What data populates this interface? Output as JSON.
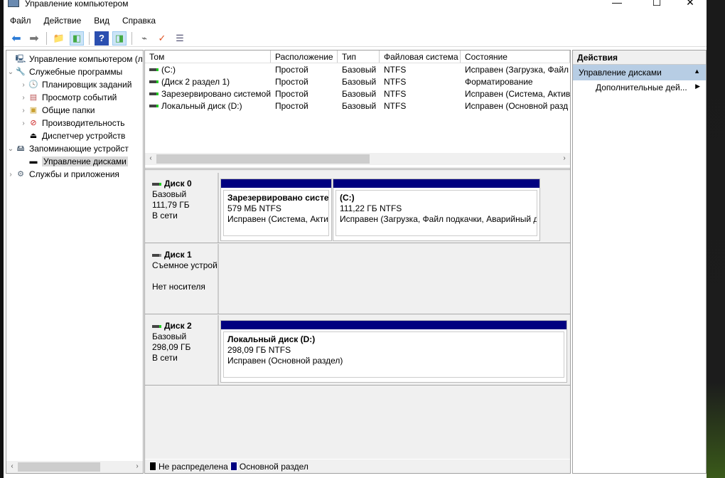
{
  "window": {
    "title": "Управление компьютером",
    "minimize": "—",
    "maximize": "☐",
    "close": "✕"
  },
  "menu": [
    "Файл",
    "Действие",
    "Вид",
    "Справка"
  ],
  "tree": [
    {
      "label": "Управление компьютером (л",
      "icon": "computer-icon"
    },
    {
      "label": "Служебные программы",
      "icon": "tools-icon"
    },
    {
      "label": "Планировщик заданий",
      "icon": "clock-icon"
    },
    {
      "label": "Просмотр событий",
      "icon": "event-viewer-icon"
    },
    {
      "label": "Общие папки",
      "icon": "shared-folder-icon"
    },
    {
      "label": "Производительность",
      "icon": "performance-icon"
    },
    {
      "label": "Диспетчер устройств",
      "icon": "device-manager-icon"
    },
    {
      "label": "Запоминающие устройст",
      "icon": "storage-icon"
    },
    {
      "label": "Управление дисками",
      "icon": "disk-icon"
    },
    {
      "label": "Службы и приложения",
      "icon": "services-icon"
    }
  ],
  "volumes": {
    "columns": [
      "Том",
      "Расположение",
      "Тип",
      "Файловая система",
      "Состояние"
    ],
    "rows": [
      [
        "(C:)",
        "Простой",
        "Базовый",
        "NTFS",
        "Исправен (Загрузка, Файл"
      ],
      [
        "(Диск 2 раздел 1)",
        "Простой",
        "Базовый",
        "NTFS",
        "Форматирование"
      ],
      [
        "Зарезервировано системой",
        "Простой",
        "Базовый",
        "NTFS",
        "Исправен (Система, Актив"
      ],
      [
        "Локальный диск (D:)",
        "Простой",
        "Базовый",
        "NTFS",
        "Исправен (Основной разд"
      ]
    ]
  },
  "disks": [
    {
      "name": "Диск 0",
      "type": "Базовый",
      "size": "111,79 ГБ",
      "status": "В сети",
      "parts": [
        {
          "name": "Зарезервировано систем",
          "size": "579 МБ NTFS",
          "state": "Исправен (Система, Актив"
        },
        {
          "name": " (C:)",
          "size": "111,22 ГБ NTFS",
          "state": "Исправен (Загрузка, Файл подкачки, Аварийный д"
        }
      ]
    },
    {
      "name": "Диск 1",
      "type": "Съемное устрой",
      "size": "",
      "status": "Нет носителя",
      "parts": []
    },
    {
      "name": "Диск 2",
      "type": "Базовый",
      "size": "298,09 ГБ",
      "status": "В сети",
      "parts": [
        {
          "name": "Локальный диск  (D:)",
          "size": "298,09 ГБ NTFS",
          "state": "Исправен (Основной раздел)"
        }
      ]
    }
  ],
  "legend": [
    {
      "label": "Не распределена",
      "color": "#000000"
    },
    {
      "label": "Основной раздел",
      "color": "#000080"
    }
  ],
  "actions": {
    "header": "Действия",
    "section": "Управление дисками",
    "item": "Дополнительные дей..."
  }
}
